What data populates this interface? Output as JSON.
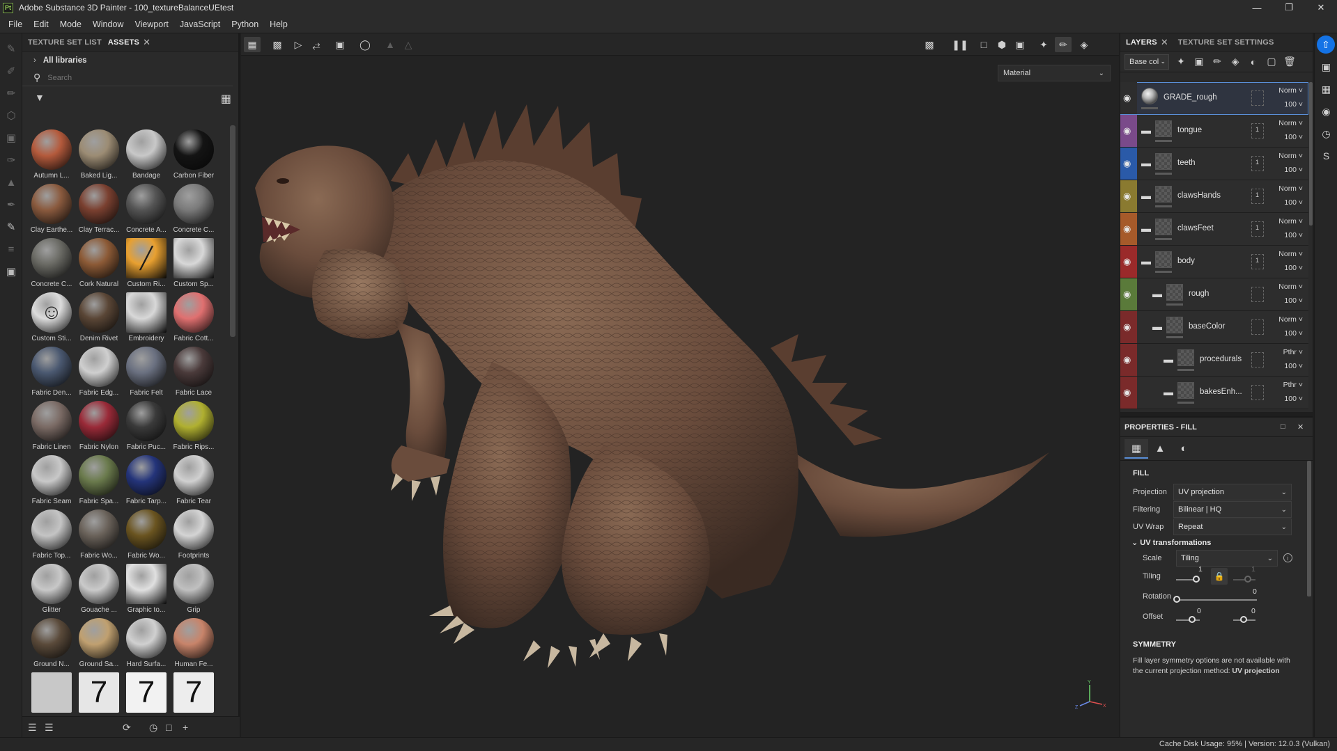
{
  "window": {
    "app_icon": "Pt",
    "title": "Adobe Substance 3D Painter - 100_textureBalanceUEtest",
    "controls": [
      "minimize",
      "maximize",
      "close"
    ]
  },
  "menu": [
    "File",
    "Edit",
    "Mode",
    "Window",
    "Viewport",
    "JavaScript",
    "Python",
    "Help"
  ],
  "assets_panel": {
    "tabs": {
      "texture_set_list": "TEXTURE SET LIST",
      "assets": "ASSETS"
    },
    "libraries_label": "All libraries",
    "search_placeholder": "Search",
    "items": [
      {
        "label": "Autumn L...",
        "color": "#b45a3c"
      },
      {
        "label": "Baked Lig...",
        "color": "#9c8c74"
      },
      {
        "label": "Bandage",
        "color": "#c8c8c8"
      },
      {
        "label": "Carbon Fiber",
        "color": "#141414"
      },
      {
        "label": "Clay Earthe...",
        "color": "#8a5a3e"
      },
      {
        "label": "Clay Terrac...",
        "color": "#7a4030"
      },
      {
        "label": "Concrete A...",
        "color": "#545454"
      },
      {
        "label": "Concrete C...",
        "color": "#7a7a7a"
      },
      {
        "label": "Concrete C...",
        "color": "#6a6a64"
      },
      {
        "label": "Cork Natural",
        "color": "#8c5a36"
      },
      {
        "label": "Custom Ri...",
        "color": "#e8a030"
      },
      {
        "label": "Custom Sp...",
        "color": "#d8d8d8"
      },
      {
        "label": "Custom Sti...",
        "color": "#dcdcdc"
      },
      {
        "label": "Denim Rivet",
        "color": "#5a4636"
      },
      {
        "label": "Embroidery",
        "color": "#d8d8d8"
      },
      {
        "label": "Fabric Cott...",
        "color": "#e07070"
      },
      {
        "label": "Fabric Den...",
        "color": "#4a5870"
      },
      {
        "label": "Fabric Edg...",
        "color": "#cfcfcf"
      },
      {
        "label": "Fabric Felt",
        "color": "#6a7080"
      },
      {
        "label": "Fabric Lace",
        "color": "#4a3a3a"
      },
      {
        "label": "Fabric Linen",
        "color": "#7a6a64"
      },
      {
        "label": "Fabric Nylon",
        "color": "#9a2a38"
      },
      {
        "label": "Fabric Puc...",
        "color": "#3a3a3a"
      },
      {
        "label": "Fabric Rips...",
        "color": "#b0b030"
      },
      {
        "label": "Fabric Seam",
        "color": "#c8c8c8"
      },
      {
        "label": "Fabric Spa...",
        "color": "#6a7a4c"
      },
      {
        "label": "Fabric Tarp...",
        "color": "#24347a"
      },
      {
        "label": "Fabric Tear",
        "color": "#d0d0d0"
      },
      {
        "label": "Fabric Top...",
        "color": "#c4c4c4"
      },
      {
        "label": "Fabric Wo...",
        "color": "#6a625a"
      },
      {
        "label": "Fabric Wo...",
        "color": "#6a5420"
      },
      {
        "label": "Footprints",
        "color": "#d4d4d4"
      },
      {
        "label": "Glitter",
        "color": "#c8c8c8"
      },
      {
        "label": "Gouache ...",
        "color": "#cacaca"
      },
      {
        "label": "Graphic to...",
        "color": "#e0e0e0"
      },
      {
        "label": "Grip",
        "color": "#c0c0c0"
      },
      {
        "label": "Ground N...",
        "color": "#5a4a3a"
      },
      {
        "label": "Ground Sa...",
        "color": "#c0a070"
      },
      {
        "label": "Hard Surfa...",
        "color": "#d0d0d0"
      },
      {
        "label": "Human Fe...",
        "color": "#c8846a"
      },
      {
        "label": "",
        "color": "#c8c8c8"
      },
      {
        "label": "",
        "color": "#e6e6e6"
      },
      {
        "label": "",
        "color": "#f2f2f2"
      },
      {
        "label": "",
        "color": "#ededed"
      }
    ]
  },
  "viewport": {
    "material_select": "Material"
  },
  "layers_panel": {
    "tabs": {
      "layers": "LAYERS",
      "texture_set_settings": "TEXTURE SET SETTINGS"
    },
    "channel": "Base col",
    "layers": [
      {
        "name": "GRADE_rough",
        "blend": "Norm",
        "opacity": "100",
        "color": "#2d2d2d",
        "indent": 0,
        "folder": false,
        "selected": true,
        "mask": ""
      },
      {
        "name": "tongue",
        "blend": "Norm",
        "opacity": "100",
        "color": "#7a4a8a",
        "indent": 0,
        "folder": true,
        "selected": false,
        "mask": "1"
      },
      {
        "name": "teeth",
        "blend": "Norm",
        "opacity": "100",
        "color": "#2a5aa8",
        "indent": 0,
        "folder": true,
        "selected": false,
        "mask": "1"
      },
      {
        "name": "clawsHands",
        "blend": "Norm",
        "opacity": "100",
        "color": "#8a7a30",
        "indent": 0,
        "folder": true,
        "selected": false,
        "mask": "1"
      },
      {
        "name": "clawsFeet",
        "blend": "Norm",
        "opacity": "100",
        "color": "#a65a2a",
        "indent": 0,
        "folder": true,
        "selected": false,
        "mask": "1"
      },
      {
        "name": "body",
        "blend": "Norm",
        "opacity": "100",
        "color": "#9a2a2a",
        "indent": 0,
        "folder": true,
        "selected": false,
        "mask": "1"
      },
      {
        "name": "rough",
        "blend": "Norm",
        "opacity": "100",
        "color": "#5a7a3a",
        "indent": 1,
        "folder": true,
        "selected": false,
        "mask": ""
      },
      {
        "name": "baseColor",
        "blend": "Norm",
        "opacity": "100",
        "color": "#7a2a2a",
        "indent": 1,
        "folder": true,
        "selected": false,
        "mask": ""
      },
      {
        "name": "procedurals",
        "blend": "Pthr",
        "opacity": "100",
        "color": "#7a2a2a",
        "indent": 2,
        "folder": true,
        "selected": false,
        "mask": ""
      },
      {
        "name": "bakesEnh...",
        "blend": "Pthr",
        "opacity": "100",
        "color": "#7a2a2a",
        "indent": 2,
        "folder": true,
        "selected": false,
        "mask": ""
      }
    ]
  },
  "properties_panel": {
    "title": "PROPERTIES - FILL",
    "fill_title": "FILL",
    "projection": {
      "label": "Projection",
      "value": "UV projection"
    },
    "filtering": {
      "label": "Filtering",
      "value": "Bilinear | HQ"
    },
    "uv_wrap": {
      "label": "UV Wrap",
      "value": "Repeat"
    },
    "uv_transformations": {
      "title": "UV transformations",
      "scale": {
        "label": "Scale",
        "value": "Tiling"
      },
      "tiling": {
        "label": "Tiling",
        "value_1": "1",
        "value_2": "1"
      },
      "rotation": {
        "label": "Rotation",
        "value": "0"
      },
      "offset": {
        "label": "Offset",
        "value_1": "0",
        "value_2": "0"
      }
    },
    "symmetry": {
      "title": "SYMMETRY",
      "text": "Fill layer symmetry options are not available with the current projection method:",
      "text_bold": "UV projection"
    }
  },
  "status_bar": {
    "text": "Cache Disk Usage:   95% | Version: 12.0.3 (Vulkan)"
  }
}
